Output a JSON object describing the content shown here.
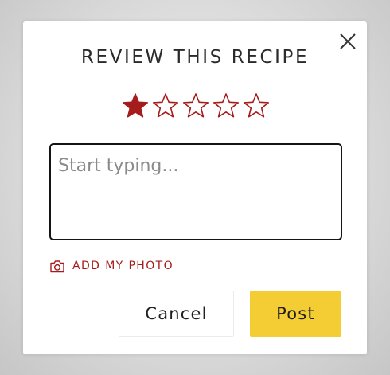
{
  "modal": {
    "title": "REVIEW THIS RECIPE",
    "close_icon": "close-icon"
  },
  "rating": {
    "value": 1,
    "max": 5,
    "filled_color": "#a51c1c",
    "icon": "star-icon"
  },
  "review_input": {
    "placeholder": "Start typing...",
    "value": ""
  },
  "add_photo": {
    "label": "ADD MY PHOTO",
    "icon": "camera-icon",
    "color": "#a51c1c"
  },
  "actions": {
    "cancel_label": "Cancel",
    "post_label": "Post",
    "post_color": "#f4cc34"
  }
}
